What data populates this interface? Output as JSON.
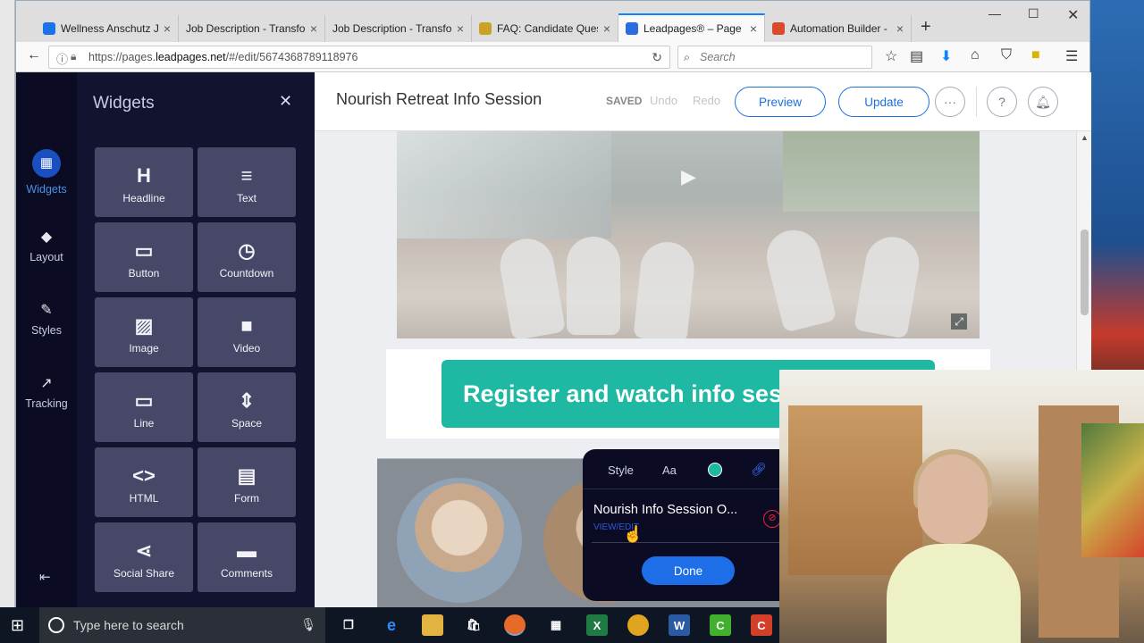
{
  "browser": {
    "tabs": [
      {
        "label": "Wellness Anschutz Jo",
        "icon_color": "#1a73e8"
      },
      {
        "label": "Job Description - Transfor",
        "icon_color": "#ffffff"
      },
      {
        "label": "Job Description - Transfor",
        "icon_color": "#ffffff"
      },
      {
        "label": "FAQ: Candidate Quest",
        "icon_color": "#c9a227"
      },
      {
        "label": "Leadpages® – Page E",
        "icon_color": "#2d6be0"
      },
      {
        "label": "Automation Builder -",
        "icon_color": "#d84a2b"
      }
    ],
    "active_tab_index": 4,
    "url_prefix": "https://pages.",
    "url_domain": "leadpages.net",
    "url_suffix": "/#/edit/5674368789118976",
    "search_placeholder": "Search",
    "accent_color": "#0a84ff"
  },
  "rail": {
    "items": [
      {
        "label": "Widgets",
        "icon": "grid-icon"
      },
      {
        "label": "Layout",
        "icon": "layers-icon"
      },
      {
        "label": "Styles",
        "icon": "brush-icon"
      },
      {
        "label": "Tracking",
        "icon": "trend-icon"
      }
    ]
  },
  "panel": {
    "title": "Widgets",
    "widgets": [
      {
        "label": "Headline",
        "glyph": "H"
      },
      {
        "label": "Text",
        "glyph": "≡"
      },
      {
        "label": "Button",
        "glyph": "▭"
      },
      {
        "label": "Countdown",
        "glyph": "◷"
      },
      {
        "label": "Image",
        "glyph": "▨"
      },
      {
        "label": "Video",
        "glyph": "■"
      },
      {
        "label": "Line",
        "glyph": "▭"
      },
      {
        "label": "Space",
        "glyph": "⇕"
      },
      {
        "label": "HTML",
        "glyph": "<>"
      },
      {
        "label": "Form",
        "glyph": "▤"
      },
      {
        "label": "Social Share",
        "glyph": "⋖"
      },
      {
        "label": "Comments",
        "glyph": "▬"
      }
    ]
  },
  "editor": {
    "page_title": "Nourish Retreat Info Session",
    "status": "SAVED",
    "undo": "Undo",
    "redo": "Redo",
    "preview": "Preview",
    "update": "Update",
    "more": "···",
    "help": "?",
    "accent_color": "#1d6fe0"
  },
  "page": {
    "register_button": "Register and watch info ses",
    "register_color": "#1fb9a3"
  },
  "popup": {
    "tab_style": "Style",
    "tab_font": "Aa",
    "link_text": "Nourish Info Session O...",
    "view_edit": "VIEW/EDIT",
    "done": "Done"
  },
  "taskbar": {
    "search_placeholder": "Type here to search"
  }
}
